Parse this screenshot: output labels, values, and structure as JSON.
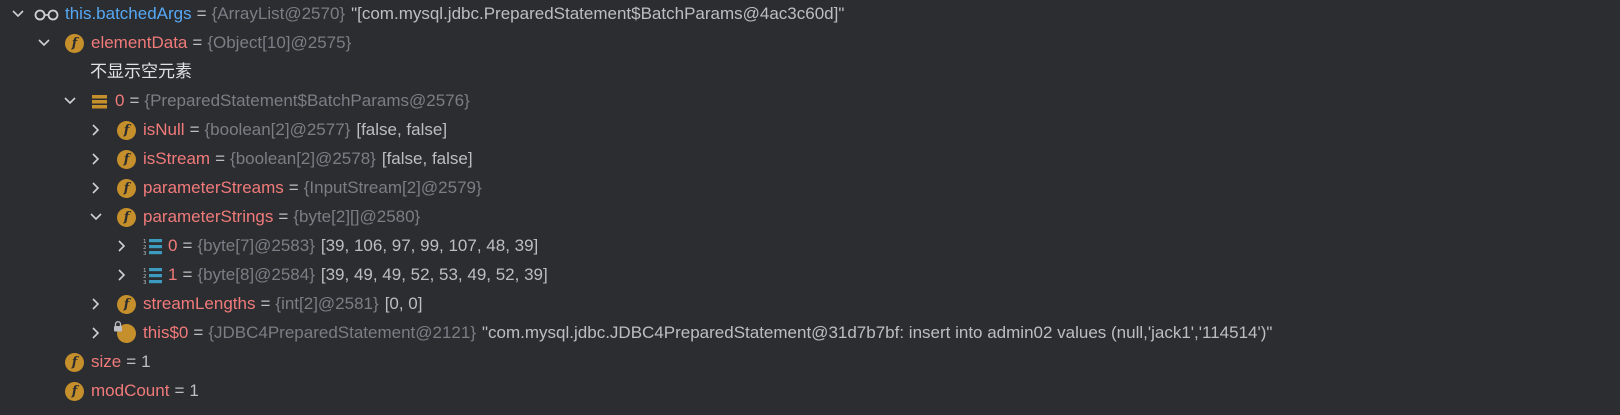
{
  "debugger": {
    "rows": [
      {
        "name": "this.batchedArgs",
        "eq": "=",
        "ref": "{ArrayList@2570}",
        "value": "\"[com.mysql.jdbc.PreparedStatement$BatchParams@4ac3c60d]\""
      },
      {
        "name": "elementData",
        "eq": "=",
        "ref": "{Object[10]@2575}",
        "value": ""
      },
      {
        "text": "不显示空元素"
      },
      {
        "name": "0",
        "eq": "=",
        "ref": "{PreparedStatement$BatchParams@2576}",
        "value": ""
      },
      {
        "name": "isNull",
        "eq": "=",
        "ref": "{boolean[2]@2577}",
        "value": "[false, false]"
      },
      {
        "name": "isStream",
        "eq": "=",
        "ref": "{boolean[2]@2578}",
        "value": "[false, false]"
      },
      {
        "name": "parameterStreams",
        "eq": "=",
        "ref": "{InputStream[2]@2579}",
        "value": ""
      },
      {
        "name": "parameterStrings",
        "eq": "=",
        "ref": "{byte[2][]@2580}",
        "value": ""
      },
      {
        "name": "0",
        "eq": "=",
        "ref": "{byte[7]@2583}",
        "value": "[39, 106, 97, 99, 107, 48, 39]"
      },
      {
        "name": "1",
        "eq": "=",
        "ref": "{byte[8]@2584}",
        "value": "[39, 49, 49, 52, 53, 49, 52, 39]"
      },
      {
        "name": "streamLengths",
        "eq": "=",
        "ref": "{int[2]@2581}",
        "value": "[0, 0]"
      },
      {
        "name": "this$0",
        "eq": "=",
        "ref": "{JDBC4PreparedStatement@2121}",
        "value": "\"com.mysql.jdbc.JDBC4PreparedStatement@31d7b7bf: insert into admin02 values (null,'jack1','114514')\""
      },
      {
        "name": "size",
        "eq": "=",
        "ref": "",
        "value": "1"
      },
      {
        "name": "modCount",
        "eq": "=",
        "ref": "",
        "value": "1"
      }
    ],
    "icons": {
      "field_letter": "f"
    },
    "colors": {
      "background": "#2b2d30",
      "field_name": "#f17a7a",
      "watch_name": "#56a8f5",
      "type_ref": "#7a7e85",
      "value": "#bcbec4",
      "field_icon": "#c58f2b"
    }
  }
}
